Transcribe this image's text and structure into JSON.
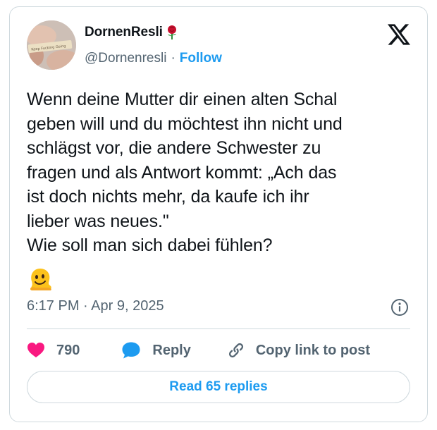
{
  "author": {
    "display_name": "DornenResli",
    "handle": "@Dornenresli",
    "separator": "·",
    "follow_label": "Follow",
    "avatar_caption": "Keep Fucking Going"
  },
  "tweet": {
    "text": "Wenn deine Mutter dir einen alten Schal\ngeben will und du möchtest ihn nicht und\nschlägst vor, die andere Schwester zu\nfragen und als Antwort kommt: „Ach das\nist doch nichts mehr, da kaufe ich ihr\nlieber was neues.\"\nWie soll man sich dabei fühlen?",
    "emoji": "melting-face",
    "timestamp": "6:17 PM · Apr 9, 2025"
  },
  "actions": {
    "like_count": "790",
    "reply_label": "Reply",
    "copy_link_label": "Copy link to post"
  },
  "footer": {
    "read_replies_label": "Read 65 replies"
  },
  "colors": {
    "accent": "#1d9bf0",
    "like": "#f91880",
    "text_primary": "#0f1419",
    "text_secondary": "#536471",
    "border": "#cfd9de"
  },
  "icons": {
    "brand": "x-logo-icon",
    "name_decoration": "rose-icon",
    "info": "info-icon",
    "like": "heart-icon",
    "reply": "speech-bubble-icon",
    "copy_link": "link-icon"
  }
}
